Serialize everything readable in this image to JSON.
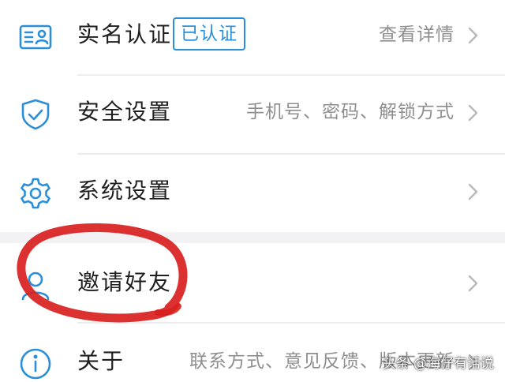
{
  "accent_color": "#2a8fd8",
  "annotation_color": "#d8201f",
  "settings": {
    "items": [
      {
        "id": "realname",
        "icon": "id-card-icon",
        "label": "实名认证",
        "badge": "已认证",
        "value": "查看详情"
      },
      {
        "id": "security",
        "icon": "shield-check-icon",
        "label": "安全设置",
        "value": "手机号、密码、解锁方式"
      },
      {
        "id": "system",
        "icon": "gear-icon",
        "label": "系统设置",
        "value": ""
      },
      {
        "id": "invite",
        "icon": "person-icon",
        "label": "邀请好友",
        "value": ""
      },
      {
        "id": "about",
        "icon": "info-icon",
        "label": "关于",
        "value": "联系方式、意见反馈、版本更新"
      }
    ]
  },
  "watermark": {
    "text": "头条 @海仔有话说"
  }
}
